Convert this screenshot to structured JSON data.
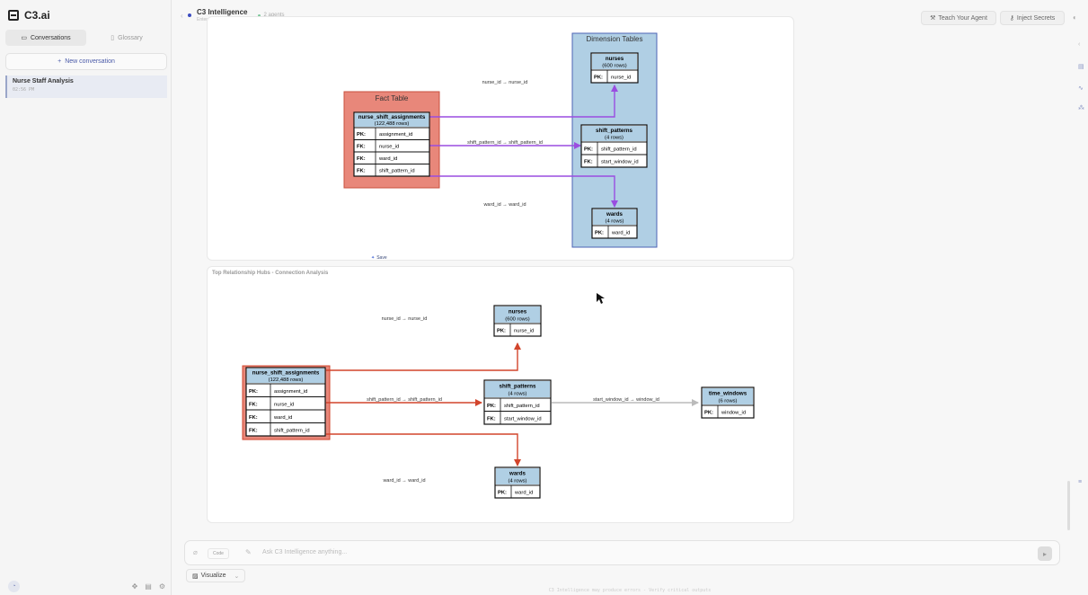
{
  "app": {
    "name": "C3.ai"
  },
  "sidebar": {
    "tabs": [
      {
        "label": "Conversations"
      },
      {
        "label": "Glossary"
      }
    ],
    "new_conversation": "New conversation",
    "conversations": [
      {
        "title": "Nurse Staff Analysis",
        "time": "02:56 PM"
      }
    ]
  },
  "header": {
    "title": "C3 Intelligence",
    "subtitle": "Enterprise AI",
    "agents": "2 agents",
    "teach_button": "Teach Your Agent",
    "secrets_button": "Inject Secrets"
  },
  "diagram1": {
    "fact_title": "Fact Table",
    "dim_title": "Dimension Tables",
    "save_label": "Save",
    "fact_table": {
      "name": "nurse_shift_assignments",
      "rows": "(122,488 rows)",
      "fields": [
        [
          "PK:",
          "assignment_id"
        ],
        [
          "FK:",
          "nurse_id"
        ],
        [
          "FK:",
          "ward_id"
        ],
        [
          "FK:",
          "shift_pattern_id"
        ]
      ]
    },
    "nurses": {
      "name": "nurses",
      "rows": "(600 rows)",
      "fields": [
        [
          "PK:",
          "nurse_id"
        ]
      ]
    },
    "shift_patterns": {
      "name": "shift_patterns",
      "rows": "(4 rows)",
      "fields": [
        [
          "PK:",
          "shift_pattern_id"
        ],
        [
          "FK:",
          "start_window_id"
        ]
      ]
    },
    "wards": {
      "name": "wards",
      "rows": "(4 rows)",
      "fields": [
        [
          "PK:",
          "ward_id"
        ]
      ]
    },
    "edges": [
      "nurse_id → nurse_id",
      "shift_pattern_id → shift_pattern_id",
      "ward_id → ward_id"
    ]
  },
  "diagram2": {
    "title": "Top Relationship Hubs - Connection Analysis",
    "hub": {
      "name": "nurse_shift_assignments",
      "rows": "(122,488 rows)",
      "fields": [
        [
          "PK:",
          "assignment_id"
        ],
        [
          "FK:",
          "nurse_id"
        ],
        [
          "FK:",
          "ward_id"
        ],
        [
          "FK:",
          "shift_pattern_id"
        ]
      ]
    },
    "nurses": {
      "name": "nurses",
      "rows": "(600 rows)",
      "fields": [
        [
          "PK:",
          "nurse_id"
        ]
      ]
    },
    "shift_patterns": {
      "name": "shift_patterns",
      "rows": "(4 rows)",
      "fields": [
        [
          "PK:",
          "shift_pattern_id"
        ],
        [
          "FK:",
          "start_window_id"
        ]
      ]
    },
    "time_windows": {
      "name": "time_windows",
      "rows": "(6 rows)",
      "fields": [
        [
          "PK:",
          "window_id"
        ]
      ]
    },
    "wards": {
      "name": "wards",
      "rows": "(4 rows)",
      "fields": [
        [
          "PK:",
          "ward_id"
        ]
      ]
    },
    "edges": [
      "nurse_id → nurse_id",
      "shift_pattern_id → shift_pattern_id",
      "start_window_id → window_id",
      "ward_id → ward_id"
    ]
  },
  "composer": {
    "code_chip": "Code",
    "placeholder": "Ask C3 Intelligence anything...",
    "visualize": "Visualize",
    "disclaimer": "C3 Intelligence may produce errors - Verify critical outputs"
  },
  "colors": {
    "accent": "#3b4cc0",
    "fact_fill": "#e8877a",
    "dim_fill": "#b0cfe4",
    "purple_edge": "#9a4de0",
    "red_edge": "#d2452c"
  }
}
